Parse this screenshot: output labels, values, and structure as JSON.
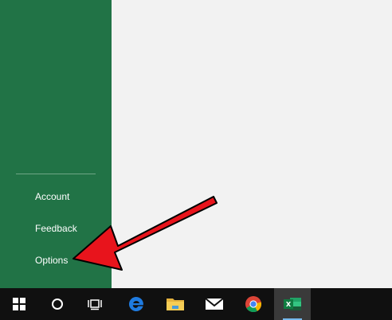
{
  "backstage": {
    "items": [
      {
        "label": "Account"
      },
      {
        "label": "Feedback"
      },
      {
        "label": "Options"
      }
    ]
  },
  "annotation": {
    "color": "#e8141c"
  },
  "taskbar": {
    "buttons": [
      {
        "icon": "windows-start-icon"
      },
      {
        "icon": "cortana-search-icon"
      },
      {
        "icon": "task-view-icon"
      },
      {
        "icon": "edge-browser-icon"
      },
      {
        "icon": "file-explorer-icon"
      },
      {
        "icon": "mail-icon"
      },
      {
        "icon": "chrome-icon"
      },
      {
        "icon": "excel-icon",
        "active": true
      }
    ]
  }
}
